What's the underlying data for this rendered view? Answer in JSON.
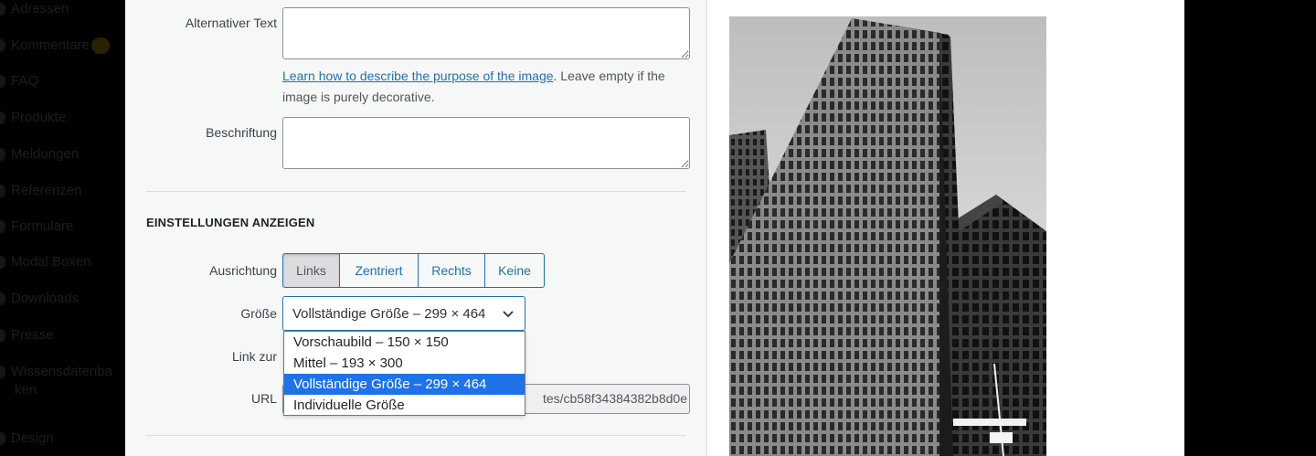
{
  "sidebar": {
    "items": [
      {
        "label": "Adressen"
      },
      {
        "label": "Kommentare"
      },
      {
        "label": "FAQ"
      },
      {
        "label": "Produkte"
      },
      {
        "label": "Meldungen"
      },
      {
        "label": "Referenzen"
      },
      {
        "label": "Formulare"
      },
      {
        "label": "Modal Boxen"
      },
      {
        "label": "Downloads"
      },
      {
        "label": "Presse"
      },
      {
        "label": "Wissensdatenbanken"
      },
      {
        "label": "Design"
      }
    ],
    "wissen_line1": "Wissensdatenba",
    "wissen_line2": "ken"
  },
  "fields": {
    "alt_text_label": "Alternativer Text",
    "alt_text_value": "",
    "help_link": "Learn how to describe the purpose of the image",
    "help_rest": ". Leave empty if the image is purely decorative.",
    "caption_label": "Beschriftung",
    "caption_value": ""
  },
  "display_settings": {
    "title": "EINSTELLUNGEN ANZEIGEN",
    "alignment_label": "Ausrichtung",
    "alignment_options": [
      "Links",
      "Zentriert",
      "Rechts",
      "Keine"
    ],
    "alignment_selected": "Links",
    "size_label": "Größe",
    "size_selected": "Vollständige Größe – 299 × 464",
    "size_options": [
      "Vorschaubild – 150 × 150",
      "Mittel – 193 × 300",
      "Vollständige Größe – 299 × 464",
      "Individuelle Größe"
    ],
    "link_label": "Link zur",
    "url_label": "URL",
    "url_value": "tes/cb58f34384382b8d0e"
  },
  "preview": {
    "image_subject": "black-and-white photo of office skyscrapers"
  },
  "colors": {
    "accent": "#2271b1",
    "selected_option": "#1e73e8"
  }
}
